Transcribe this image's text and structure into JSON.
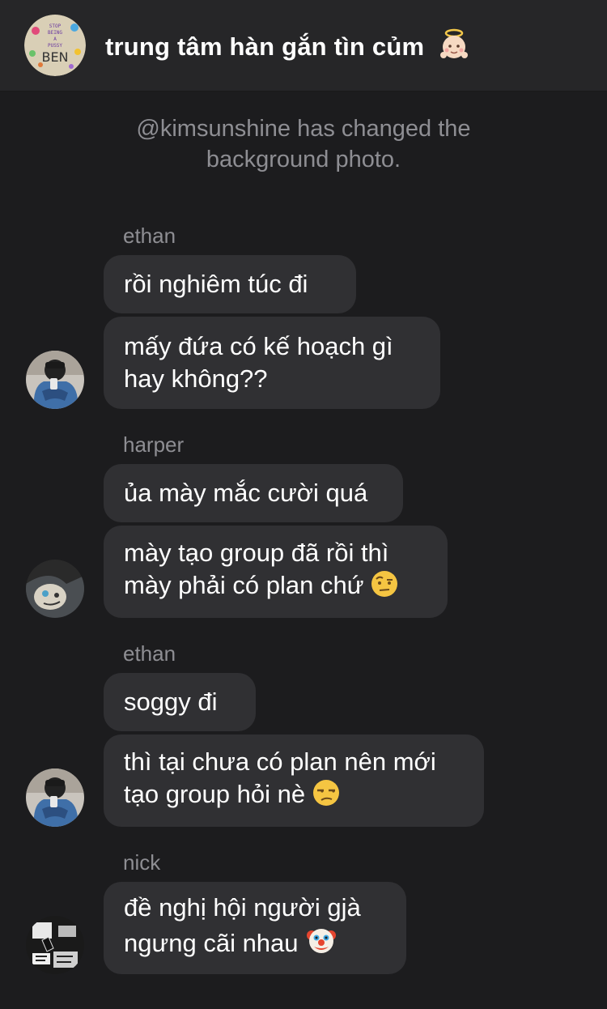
{
  "header": {
    "title": "trung tâm hàn gắn tìn củm",
    "title_emoji": "baby-angel-emoji",
    "group_avatar_text": "BEN",
    "group_avatar_small_text": [
      "STOP",
      "BEING",
      "A",
      "PUSSY"
    ]
  },
  "system_message": {
    "line1": "@kimsunshine has changed the",
    "line2": "background photo."
  },
  "groups": [
    {
      "sender": "ethan",
      "messages": [
        {
          "lines": [
            "rồi nghiêm túc đi"
          ]
        },
        {
          "lines": [
            "mấy đứa có kế hoạch gì",
            "hay không??"
          ]
        }
      ]
    },
    {
      "sender": "harper",
      "messages": [
        {
          "lines": [
            "ủa mày mắc cười quá"
          ]
        },
        {
          "lines": [
            "mày tạo group đã rồi thì",
            "mày phải có plan chứ"
          ],
          "emoji": "raised-eyebrow-emoji"
        }
      ]
    },
    {
      "sender": "ethan",
      "messages": [
        {
          "lines": [
            "soggy đi"
          ]
        },
        {
          "lines": [
            "thì tại chưa có plan nên mới",
            "tạo group hỏi nè"
          ],
          "emoji": "unamused-emoji"
        }
      ]
    },
    {
      "sender": "nick",
      "messages": [
        {
          "lines": [
            "đề nghị hội người gjà",
            "ngưng cãi nhau"
          ],
          "emoji": "clown-face-emoji"
        }
      ]
    }
  ],
  "colors": {
    "background": "#1c1c1e",
    "header": "#262628",
    "bubble": "#303033",
    "secondary_text": "#8e8e93"
  }
}
